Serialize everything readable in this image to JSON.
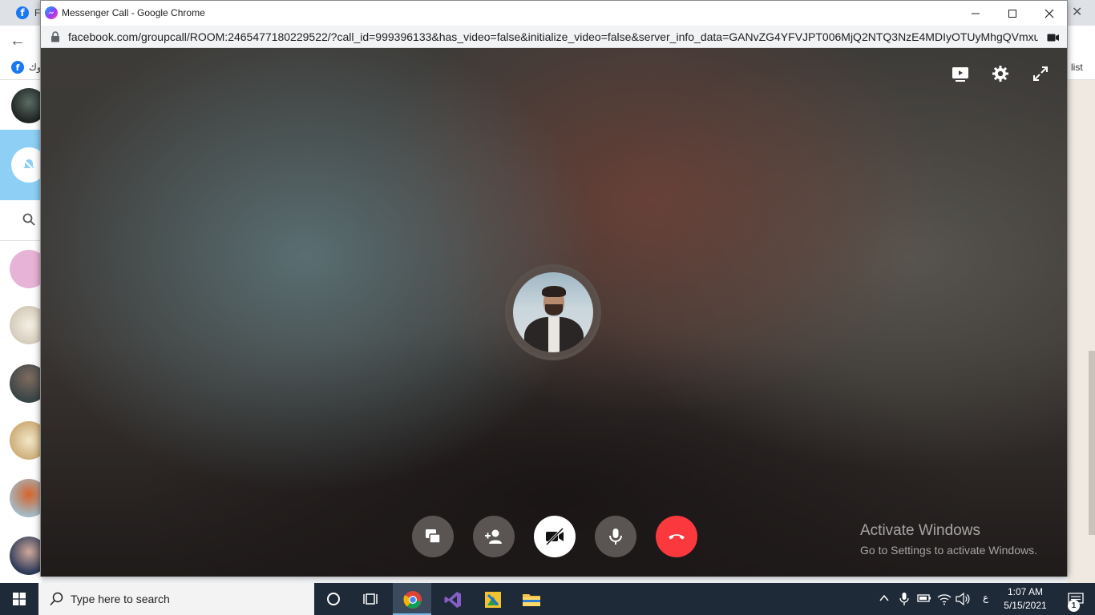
{
  "background_browser": {
    "tab_letter": "F",
    "bookmark_arabic": "وك",
    "bookmark_right": "list"
  },
  "popup": {
    "window_title": "Messenger Call - Google Chrome",
    "url": "facebook.com/groupcall/ROOM:2465477180229522/?call_id=999396133&has_video=false&initialize_video=false&server_info_data=GANvZG4YFVJPT006MjQ2NTQ3NzE4MDIyOTUyMhgQVmxuV...",
    "top_controls": [
      "present-icon",
      "settings-icon",
      "fullscreen-icon"
    ],
    "call_controls": [
      {
        "name": "share-screen",
        "icon": "screen-share-icon"
      },
      {
        "name": "add-person",
        "icon": "add-person-icon"
      },
      {
        "name": "video-off",
        "icon": "video-off-icon"
      },
      {
        "name": "microphone",
        "icon": "microphone-icon"
      },
      {
        "name": "end-call",
        "icon": "phone-hangup-icon"
      }
    ],
    "end_call_color": "#fa383e"
  },
  "watermark": {
    "title": "Activate Windows",
    "subtitle": "Go to Settings to activate Windows."
  },
  "taskbar": {
    "search_placeholder": "Type here to search",
    "language": "ع",
    "time": "1:07 AM",
    "date": "5/15/2021",
    "notification_count": "1"
  }
}
